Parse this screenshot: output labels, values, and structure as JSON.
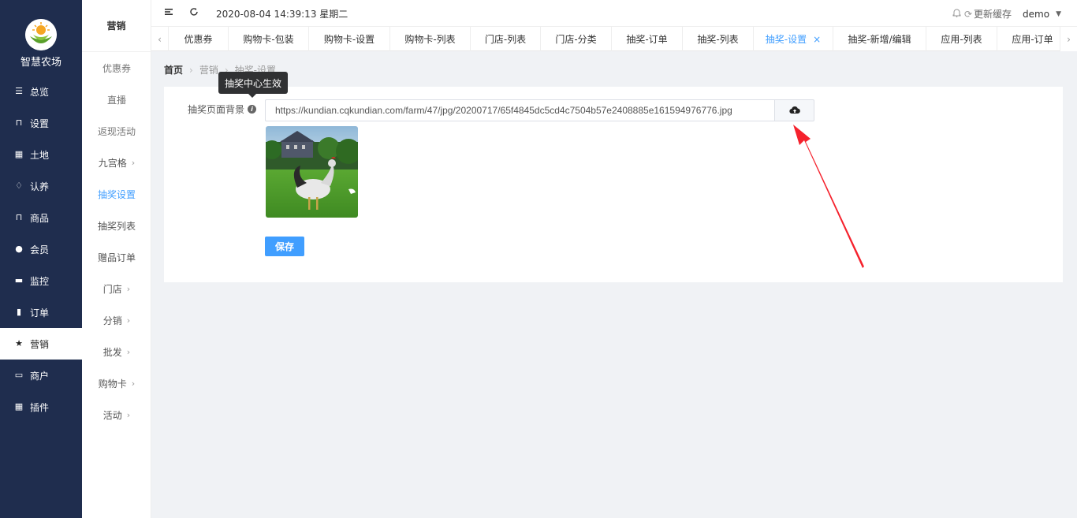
{
  "brand": "智慧农场",
  "nav": [
    {
      "label": "总览",
      "icon": "sliders-icon",
      "glyph": "☰"
    },
    {
      "label": "设置",
      "icon": "bag-icon",
      "glyph": "⊓"
    },
    {
      "label": "土地",
      "icon": "grid-icon",
      "glyph": "▦"
    },
    {
      "label": "认养",
      "icon": "gem-icon",
      "glyph": "♢"
    },
    {
      "label": "商品",
      "icon": "bag-icon",
      "glyph": "⊓"
    },
    {
      "label": "会员",
      "icon": "user-icon",
      "glyph": "●"
    },
    {
      "label": "监控",
      "icon": "camera-icon",
      "glyph": "▬"
    },
    {
      "label": "订单",
      "icon": "clipboard-icon",
      "glyph": "▮"
    },
    {
      "label": "营销",
      "icon": "star-icon",
      "glyph": "★"
    },
    {
      "label": "商户",
      "icon": "store-icon",
      "glyph": "▭"
    },
    {
      "label": "插件",
      "icon": "grid-icon",
      "glyph": "▦"
    }
  ],
  "submenu": {
    "title": "营销",
    "items": [
      {
        "label": "优惠券"
      },
      {
        "label": "直播"
      },
      {
        "label": "返现活动"
      },
      {
        "label": "九宫格",
        "chevron": "›"
      },
      {
        "label": "抽奖设置"
      },
      {
        "label": "抽奖列表"
      },
      {
        "label": "赠品订单"
      },
      {
        "label": "门店",
        "chevron": "›"
      },
      {
        "label": "分销",
        "chevron": "›"
      },
      {
        "label": "批发",
        "chevron": "›"
      },
      {
        "label": "购物卡",
        "chevron": "›"
      },
      {
        "label": "活动",
        "chevron": "›"
      }
    ]
  },
  "header": {
    "datetime": "2020-08-04 14:39:13 星期二",
    "refresh_cache": "更新缓存",
    "user": "demo"
  },
  "tabs": [
    {
      "label": "优惠券"
    },
    {
      "label": "购物卡-包装"
    },
    {
      "label": "购物卡-设置"
    },
    {
      "label": "购物卡-列表"
    },
    {
      "label": "门店-列表"
    },
    {
      "label": "门店-分类"
    },
    {
      "label": "抽奖-订单"
    },
    {
      "label": "抽奖-列表"
    },
    {
      "label": "抽奖-设置"
    },
    {
      "label": "抽奖-新增/编辑"
    },
    {
      "label": "应用-列表"
    },
    {
      "label": "应用-订单"
    }
  ],
  "breadcrumb": {
    "home": "首页",
    "level1": "营销",
    "level2": "抽奖-设置"
  },
  "tooltip": "抽奖中心生效",
  "form": {
    "bg_label": "抽奖页面背景",
    "bg_url": "https://kundian.cqkundian.com/farm/47/jpg/20200717/65f4845dc5cd4c7504b57e2408885e161594976776.jpg",
    "save_label": "保存"
  },
  "colors": {
    "sidebar": "#1f2d4e",
    "accent": "#409eff",
    "annotation_arrow": "#f5222d"
  }
}
